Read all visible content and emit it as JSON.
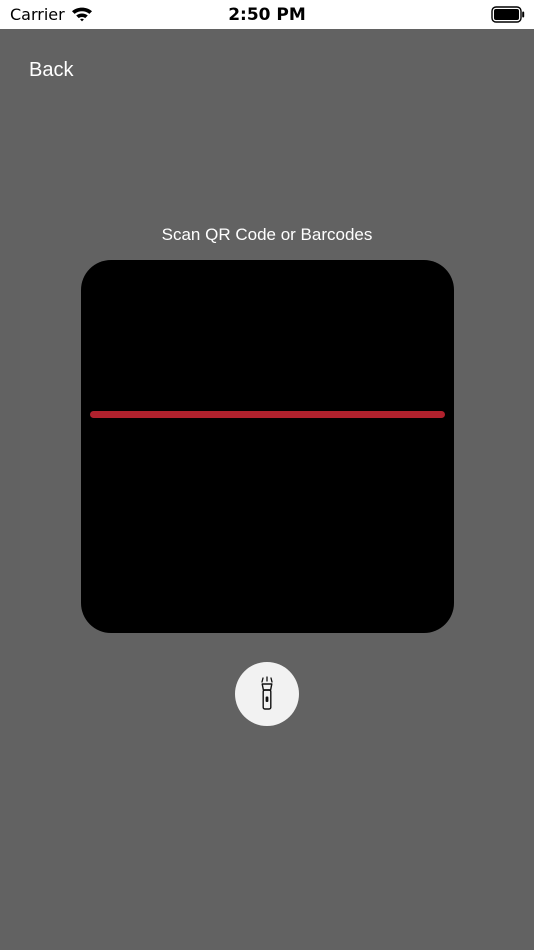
{
  "status_bar": {
    "carrier": "Carrier",
    "time": "2:50 PM",
    "wifi_icon": "wifi-icon",
    "battery_icon": "battery-icon"
  },
  "nav": {
    "back_label": "Back"
  },
  "scanner": {
    "title": "Scan QR Code or Barcodes",
    "scan_line_color": "#b0212d",
    "torch_icon": "flashlight-icon"
  },
  "colors": {
    "background": "#626262",
    "scanner_view": "#000000",
    "torch_button": "#f2f2f2"
  }
}
